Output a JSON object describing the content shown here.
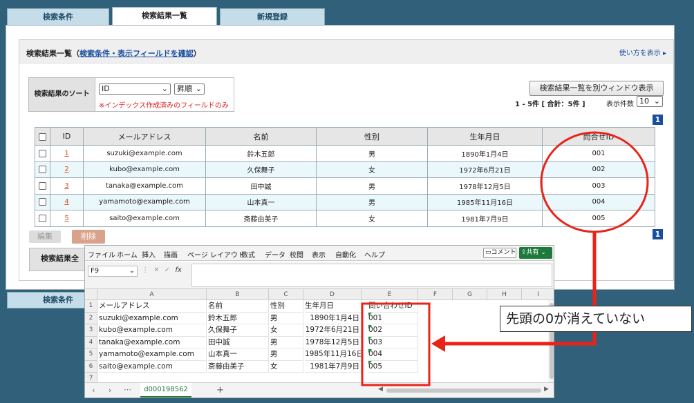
{
  "tabs": [
    "検索条件",
    "検索結果一覧",
    "新規登録"
  ],
  "bottom_tab": "検索条件",
  "section": {
    "title": "検索結果一覧",
    "paren_open": "（",
    "confirm_link": "検索条件・表示フィールドを確認",
    "paren_close": "）",
    "help_link": "使い方を表示 ▸"
  },
  "sort": {
    "label": "検索結果のソート",
    "field_value": "ID",
    "order_value": "昇順",
    "note": "※インデックス作成済みのフィールドのみ"
  },
  "open_window_button": "検索結果一覧を別ウィンドウ表示",
  "results_summary": "1 - 5件 [ 合計：5件 ]",
  "per_page_label": "表示件数",
  "per_page_value": "10",
  "page_number": "1",
  "table": {
    "headers": [
      "ID",
      "メールアドレス",
      "名前",
      "性別",
      "生年月日",
      "問合せID"
    ],
    "rows": [
      [
        "1",
        "suzuki@example.com",
        "鈴木五郎",
        "男",
        "1890年1月4日",
        "001"
      ],
      [
        "2",
        "kubo@example.com",
        "久保舞子",
        "女",
        "1972年6月21日",
        "002"
      ],
      [
        "3",
        "tanaka@example.com",
        "田中誠",
        "男",
        "1978年12月5日",
        "003"
      ],
      [
        "4",
        "yamamoto@example.com",
        "山本真一",
        "男",
        "1985年11月16日",
        "004"
      ],
      [
        "5",
        "saito@example.com",
        "斎藤由美子",
        "女",
        "1981年7月9日",
        "005"
      ]
    ]
  },
  "edit_button": "編集",
  "delete_button": "削除",
  "bulk_partial": "検索結果全",
  "excel": {
    "menu": [
      "ファイル",
      "ホーム",
      "挿入",
      "描画",
      "ページ レイアウト",
      "数式",
      "データ",
      "校閲",
      "表示",
      "自動化",
      "ヘルプ"
    ],
    "comment_button": "コメント",
    "share_button": "共有",
    "name_box": "F9",
    "fx": "fx",
    "columns": [
      "A",
      "B",
      "C",
      "D",
      "E",
      "F",
      "G",
      "H",
      "I"
    ],
    "row_numbers": [
      "1",
      "2",
      "3",
      "4",
      "5",
      "6",
      "7"
    ],
    "rows": [
      [
        "メールアドレス",
        "名前",
        "性別",
        "生年月日",
        "問い合わせID"
      ],
      [
        "suzuki@example.com",
        "鈴木五郎",
        "男",
        "1890年1月4日",
        "001"
      ],
      [
        "kubo@example.com",
        "久保舞子",
        "女",
        "1972年6月21日",
        "002"
      ],
      [
        "tanaka@example.com",
        "田中誠",
        "男",
        "1978年12月5日",
        "003"
      ],
      [
        "yamamoto@example.com",
        "山本真一",
        "男",
        "1985年11月16日",
        "004"
      ],
      [
        "saito@example.com",
        "斎藤由美子",
        "女",
        "1981年7月9日",
        "005"
      ]
    ],
    "sheet_tab": "d000198562",
    "add_sheet": "+"
  },
  "callout": "先頭の0が消えていない",
  "colors": {
    "highlight": "#e8241a",
    "page_badge": "#1a4d9a",
    "row_alt": "#eaf8fb"
  }
}
